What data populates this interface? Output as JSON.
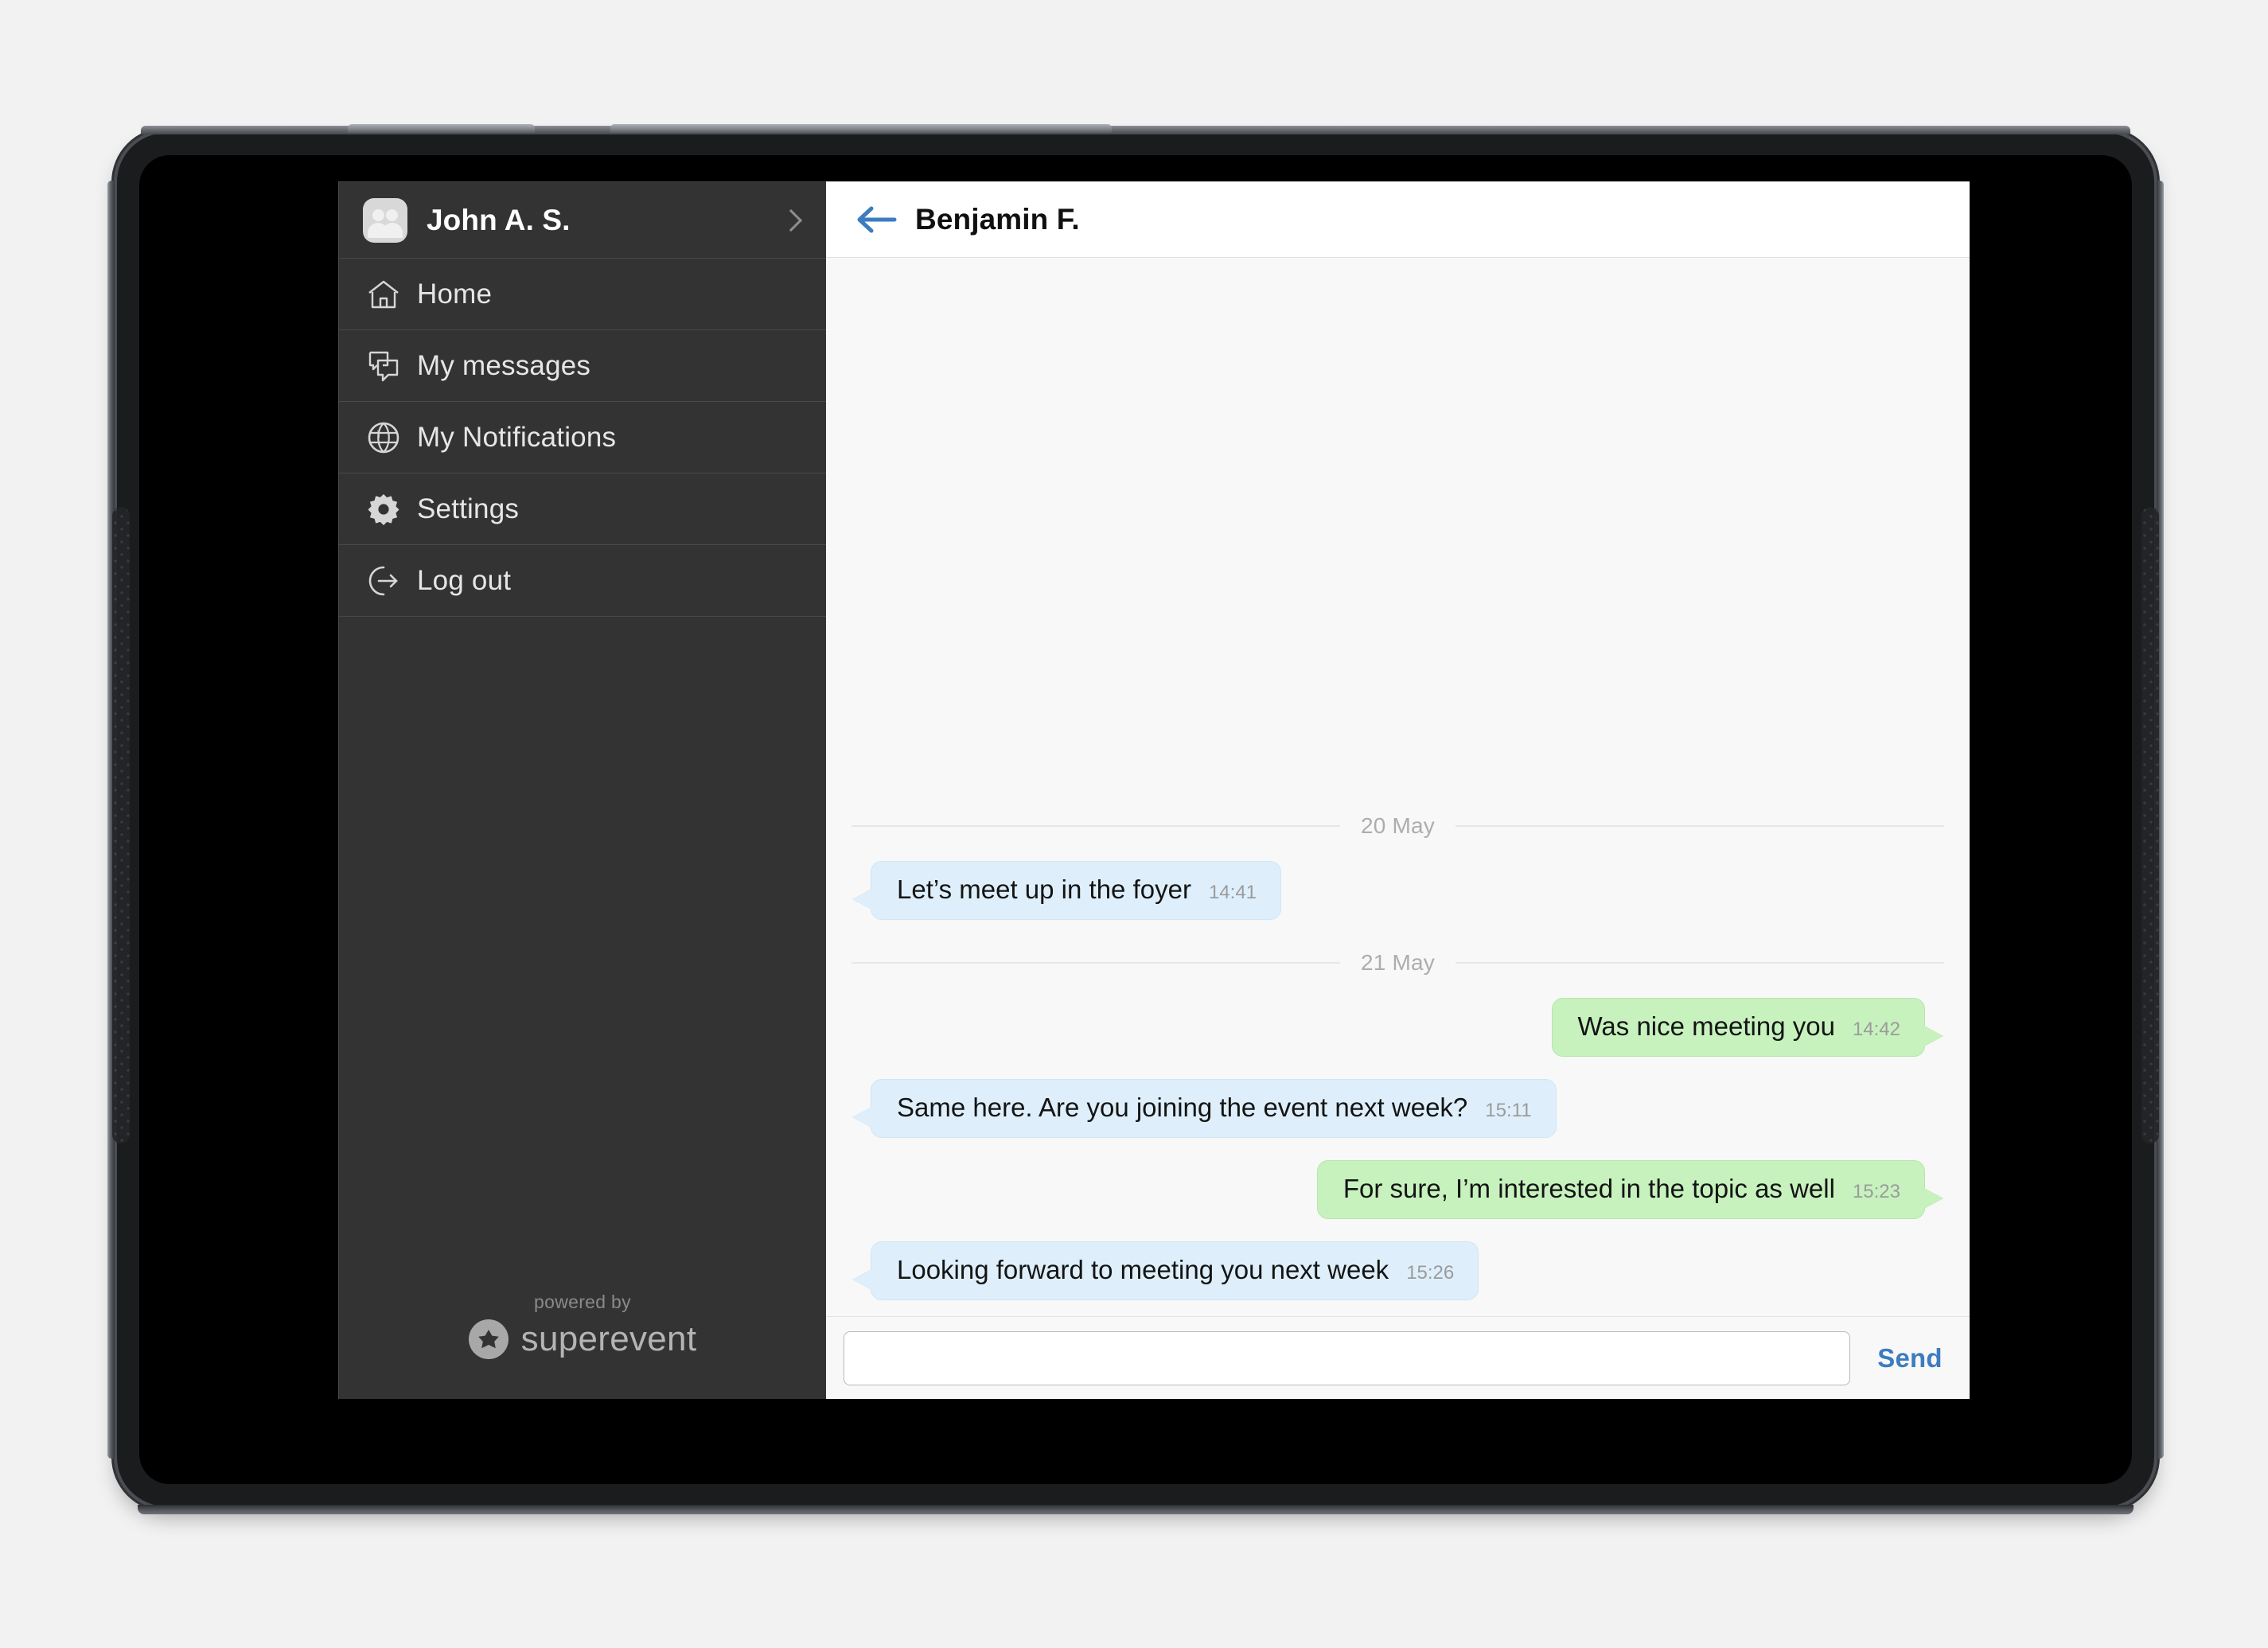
{
  "device": {
    "type": "tablet",
    "camera_icon": "camera-dot"
  },
  "sidebar": {
    "profile": {
      "name": "John A. S.",
      "avatar_icon": "people-avatar-icon",
      "chevron_icon": "chevron-right-icon"
    },
    "items": [
      {
        "label": "Home",
        "icon": "home-icon"
      },
      {
        "label": "My messages",
        "icon": "messages-icon"
      },
      {
        "label": "My Notifications",
        "icon": "globe-icon"
      },
      {
        "label": "Settings",
        "icon": "gear-icon"
      },
      {
        "label": "Log out",
        "icon": "logout-icon"
      }
    ],
    "footer": {
      "powered_by": "powered by",
      "brand": "superevent",
      "brand_icon": "star-badge-icon"
    }
  },
  "chat": {
    "header": {
      "title": "Benjamin F.",
      "back_icon": "back-arrow-icon"
    },
    "threads": [
      {
        "date": "20 May",
        "messages": [
          {
            "direction": "in",
            "text": "Let’s meet up in the foyer",
            "time": "14:41"
          }
        ]
      },
      {
        "date": "21 May",
        "messages": [
          {
            "direction": "out",
            "text": "Was nice meeting you",
            "time": "14:42"
          },
          {
            "direction": "in",
            "text": "Same here. Are you joining the event next week?",
            "time": "15:11"
          },
          {
            "direction": "out",
            "text": "For sure, I’m interested in the topic as well",
            "time": "15:23"
          },
          {
            "direction": "in",
            "text": "Looking forward to meeting you next week",
            "time": "15:26"
          }
        ]
      }
    ],
    "composer": {
      "value": "",
      "placeholder": "",
      "send_label": "Send"
    }
  },
  "colors": {
    "page_background": "#f2f2f2",
    "device_body": "#1b1c1e",
    "sidebar_background": "#333333",
    "sidebar_divider": "#4a4a4a",
    "chat_background": "#f8f8f8",
    "incoming_bubble": "#deeffb",
    "outgoing_bubble": "#c7f2be",
    "accent_blue": "#3c7cbf",
    "timestamp_grey": "#9b9b9b",
    "date_separator_grey": "#adadad"
  }
}
